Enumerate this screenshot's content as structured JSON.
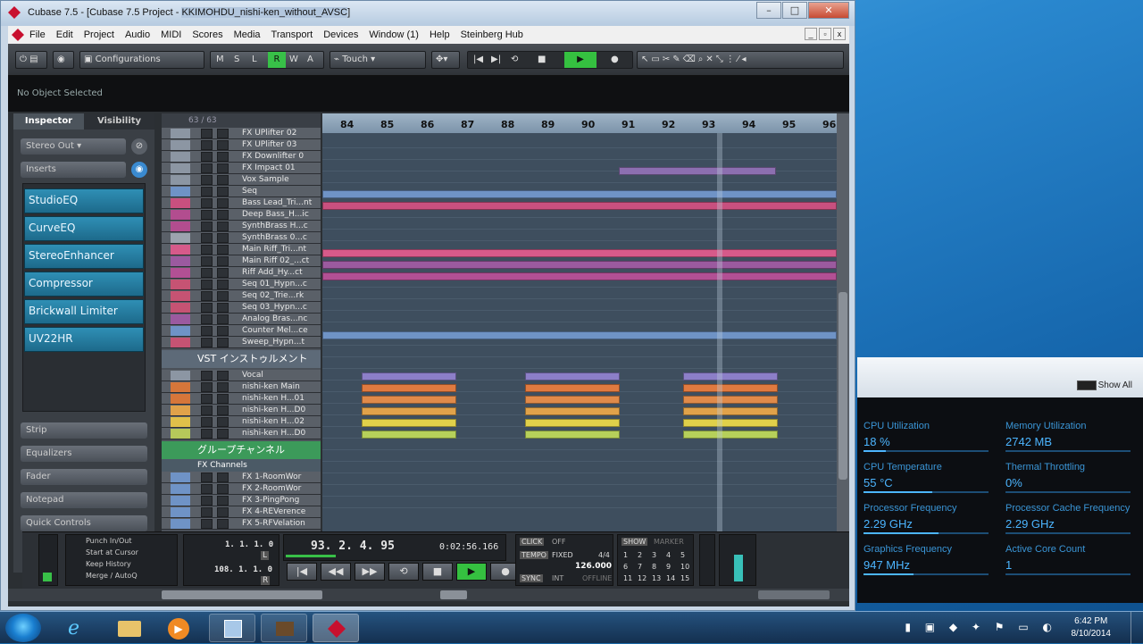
{
  "window": {
    "title_prefix": "Cubase 7.5 - [Cubase 7.5 Project - ",
    "title_highlight": "KKIMOHDU_nishi-ken_without_AVSC",
    "title_suffix": "]"
  },
  "menu": [
    "File",
    "Edit",
    "Project",
    "Audio",
    "MIDI",
    "Scores",
    "Media",
    "Transport",
    "Devices",
    "Window (1)",
    "Help",
    "Steinberg Hub"
  ],
  "toolbar": {
    "configurations": "Configurations",
    "mode_letters": [
      "M",
      "S",
      "L",
      "R",
      "W",
      "A"
    ],
    "automation_mode": "Touch"
  },
  "info_line": "No Object Selected",
  "inspector": {
    "tab_inspector": "Inspector",
    "tab_visibility": "Visibility",
    "output": "Stereo Out",
    "inserts_label": "Inserts",
    "inserts": [
      "StudioEQ",
      "CurveEQ",
      "StereoEnhancer",
      "Compressor",
      "Brickwall Limiter",
      "UV22HR"
    ],
    "sections": [
      "Strip",
      "Equalizers",
      "Fader",
      "Notepad",
      "Quick Controls"
    ]
  },
  "tracklist": {
    "count": "63 / 63",
    "tracks": [
      {
        "name": "FX UPlifter 02",
        "color": "#8c96a3"
      },
      {
        "name": "FX UPlifter 03",
        "color": "#8c96a3"
      },
      {
        "name": "FX Downlifter 0",
        "color": "#8c96a3"
      },
      {
        "name": "FX Impact 01",
        "color": "#8c96a3"
      },
      {
        "name": "Vox Sample",
        "color": "#8c96a3"
      },
      {
        "name": "Seq",
        "color": "#6f93c6"
      },
      {
        "name": "Bass Lead_Tri...nt",
        "color": "#c8507f"
      },
      {
        "name": "Deep Bass_H...ic",
        "color": "#b24d8f"
      },
      {
        "name": "SynthBrass H...c",
        "color": "#b24d8f"
      },
      {
        "name": "SynthBrass 0...c",
        "color": "#9ca3ae"
      },
      {
        "name": "Main Riff_Tri...nt",
        "color": "#d65a8a"
      },
      {
        "name": "Main Riff 02_...ct",
        "color": "#9b5a9f"
      },
      {
        "name": "Riff Add_Hy...ct",
        "color": "#b25094"
      },
      {
        "name": "Seq 01_Hypn...c",
        "color": "#c65373"
      },
      {
        "name": "Seq 02_Trie...rk",
        "color": "#c65373"
      },
      {
        "name": "Seq 03_Hypn...c",
        "color": "#c65373"
      },
      {
        "name": "Analog Bras...nc",
        "color": "#9b5a9f"
      },
      {
        "name": "Counter Mel...ce",
        "color": "#6f93c6"
      },
      {
        "name": "Sweep_Hypn...t",
        "color": "#c65373"
      }
    ],
    "folder_vst": "VST インストゥルメント",
    "vocal_tracks": [
      {
        "name": "Vocal",
        "color": "#8c96a3"
      },
      {
        "name": "nishi-ken Main",
        "color": "#d6763a"
      },
      {
        "name": "nishi-ken H...01",
        "color": "#d6763a"
      },
      {
        "name": "nishi-ken H...D0",
        "color": "#e0a24a"
      },
      {
        "name": "nishi-ken H...02",
        "color": "#e0c04a"
      },
      {
        "name": "nishi-ken H...D0",
        "color": "#b6c85a"
      }
    ],
    "folder_group": "グループチャンネル",
    "fx_channels_label": "FX Channels",
    "fx_tracks": [
      {
        "name": "FX 1-RoomWor",
        "color": "#6f93c6"
      },
      {
        "name": "FX 2-RoomWor",
        "color": "#6f93c6"
      },
      {
        "name": "FX 3-PingPong",
        "color": "#6f93c6"
      },
      {
        "name": "FX 4-REVerence",
        "color": "#6f93c6"
      },
      {
        "name": "FX 5-RFVelation",
        "color": "#6f93c6"
      }
    ]
  },
  "ruler": [
    "84",
    "85",
    "86",
    "87",
    "88",
    "89",
    "90",
    "91",
    "92",
    "93",
    "94",
    "95",
    "96"
  ],
  "transport": {
    "punch_in": "Punch In/Out",
    "start_cursor": "Start at Cursor",
    "keep_history": "Keep History",
    "merge": "Merge / AutoQ",
    "left_locator": "1. 1. 1. 0",
    "right_locator": "108. 1. 1. 0",
    "position": "93. 2. 4. 95",
    "time": "0:02:56.166",
    "click": "CLICK",
    "click_state": "OFF",
    "tempo": "TEMPO",
    "tempo_mode": "FIXED",
    "signature": "4/4",
    "bpm": "126.000",
    "sync": "SYNC",
    "sync_mode": "INT",
    "sync_state": "OFFLINE",
    "show": "SHOW",
    "marker": "MARKER",
    "markers": [
      "1",
      "2",
      "3",
      "4",
      "5",
      "6",
      "7",
      "8",
      "9",
      "10",
      "11",
      "12",
      "13",
      "14",
      "15"
    ],
    "lr_labels": [
      "L",
      "R"
    ]
  },
  "gadget": {
    "show_all": "Show All",
    "items": [
      {
        "label": "CPU Utilization",
        "value": "18 %",
        "level": 0.18
      },
      {
        "label": "Memory Utilization",
        "value": "2742  MB",
        "level": 0.0
      },
      {
        "label": "CPU Temperature",
        "value": "55 °C",
        "level": 0.55
      },
      {
        "label": "Thermal Throttling",
        "value": "0%",
        "level": 0.0
      },
      {
        "label": "Processor Frequency",
        "value": "2.29 GHz",
        "level": 0.6
      },
      {
        "label": "Processor Cache Frequency",
        "value": "2.29 GHz",
        "level": 0.0
      },
      {
        "label": "Graphics Frequency",
        "value": "947 MHz",
        "level": 0.4
      },
      {
        "label": "Active Core Count",
        "value": "1",
        "level": 0.0
      }
    ]
  },
  "clock": {
    "time": "6:42 PM",
    "date": "8/10/2014"
  }
}
